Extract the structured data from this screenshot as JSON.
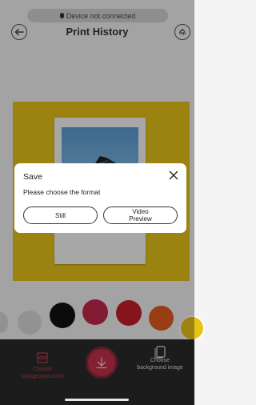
{
  "status": {
    "text": "Device not connected"
  },
  "header": {
    "title": "Print History",
    "top_label": "top"
  },
  "dialog": {
    "title": "Save",
    "message": "Please choose the format",
    "still_label": "Still",
    "video_label_line1": "Video",
    "video_label_line2": "Preview"
  },
  "bottom": {
    "bg_color_line1": "Choose",
    "bg_color_line2": "background color",
    "bg_image_line1": "Choose",
    "bg_image_line2": "background image"
  },
  "colors": {
    "canvas": "#e3c21a",
    "accent": "#c2314a",
    "swatches": [
      "#d7d7d7",
      "#111111",
      "#c2284a",
      "#c51e2a",
      "#e05a1e",
      "#e8c218"
    ]
  },
  "icons": [
    "back-arrow-icon",
    "top-icon",
    "close-icon",
    "background-color-icon",
    "download-icon",
    "background-image-icon"
  ]
}
